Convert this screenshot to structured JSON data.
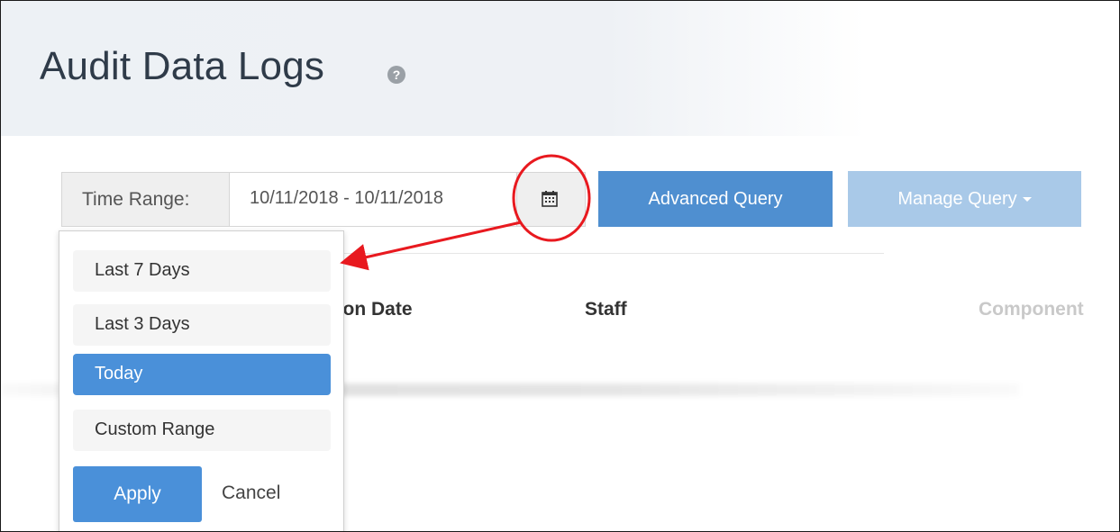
{
  "page": {
    "title": "Audit Data Logs",
    "help_icon_glyph": "?"
  },
  "toolbar": {
    "time_range_label": "Time Range:",
    "date_range_value": "10/11/2018 - 10/11/2018",
    "calendar_icon": "calendar-icon",
    "advanced_query_label": "Advanced Query",
    "manage_query_label": "Manage Query"
  },
  "table": {
    "columns": [
      "ation Date",
      "Staff",
      "Component"
    ]
  },
  "dropdown": {
    "items": [
      {
        "label": "Last 7 Days",
        "selected": false
      },
      {
        "label": "Last 3 Days",
        "selected": false
      },
      {
        "label": "Today",
        "selected": true
      },
      {
        "label": "Custom Range",
        "selected": false
      }
    ],
    "apply_label": "Apply",
    "cancel_label": "Cancel"
  },
  "colors": {
    "primary_blue": "#4a90d9",
    "disabled_blue": "#a9c9e8",
    "annotation_red": "#e8191f"
  }
}
